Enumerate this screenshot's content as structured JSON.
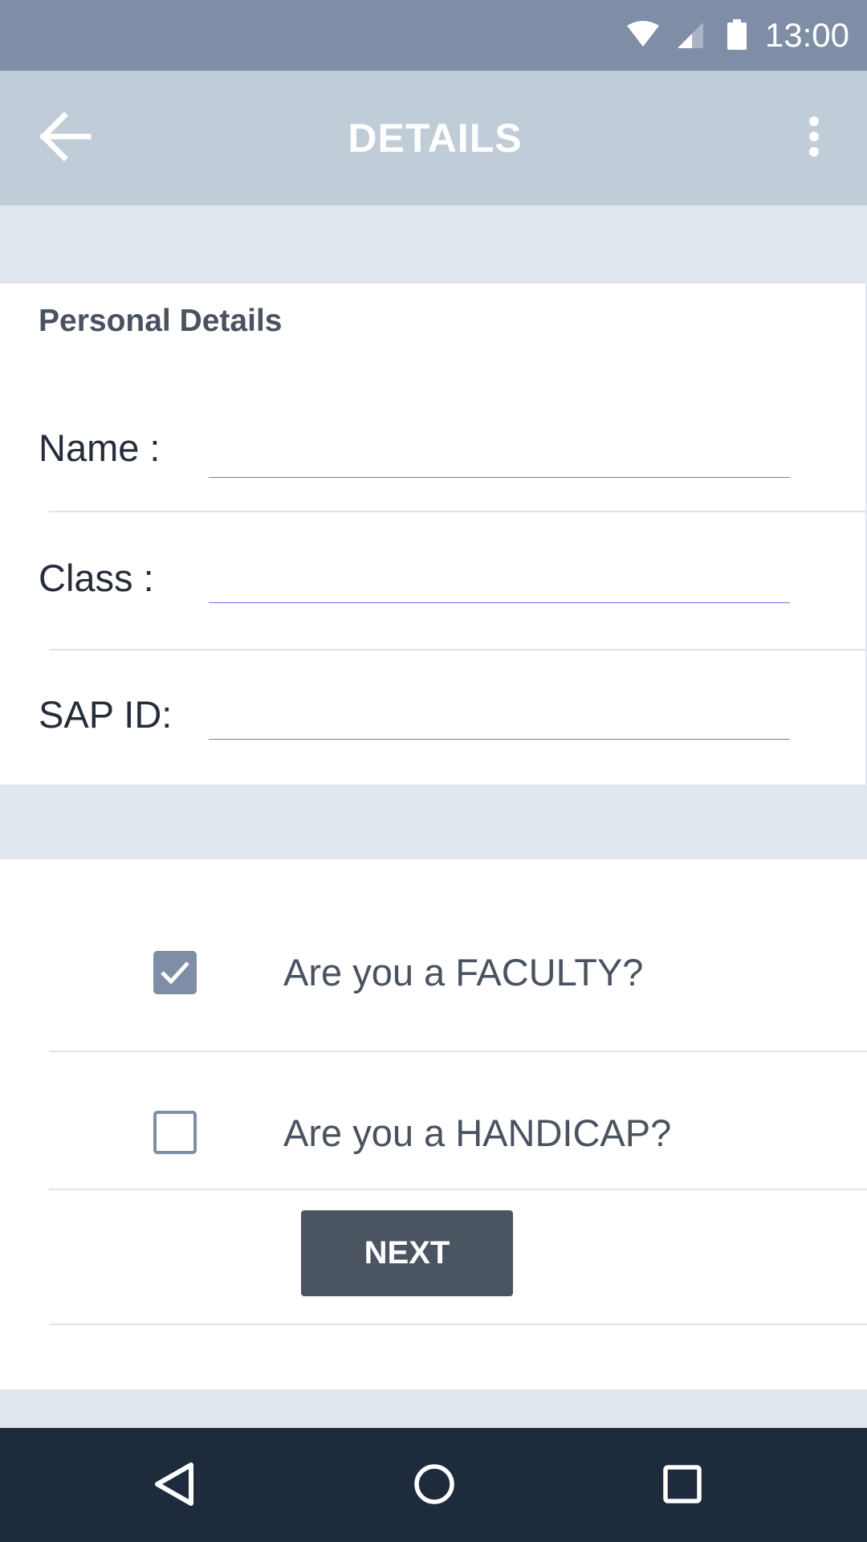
{
  "status_bar": {
    "time": "13:00",
    "icons": [
      "wifi-icon",
      "cellular-signal-icon",
      "battery-icon"
    ]
  },
  "app_bar": {
    "title": "DETAILS",
    "back_icon": "arrow-left-icon",
    "menu_icon": "more-vert-icon"
  },
  "personal_details": {
    "section_title": "Personal Details",
    "fields": [
      {
        "label": "Name :",
        "value": ""
      },
      {
        "label": "Class :",
        "value": ""
      },
      {
        "label": "SAP ID:",
        "value": ""
      }
    ]
  },
  "questions": [
    {
      "label": "Are you a FACULTY?",
      "checked": true
    },
    {
      "label": "Are you a HANDICAP?",
      "checked": false
    }
  ],
  "next_button": {
    "label": "NEXT"
  },
  "nav_bar": {
    "icons": [
      "back-triangle-icon",
      "home-circle-icon",
      "recents-square-icon"
    ]
  },
  "colors": {
    "status_bar": "#7f8ea6",
    "app_bar": "#c1ccd9",
    "page_background": "#e0e6ee",
    "accent_underline": "#7b6ee0",
    "button": "#4b5562",
    "nav_bar": "#1e2b3c"
  }
}
